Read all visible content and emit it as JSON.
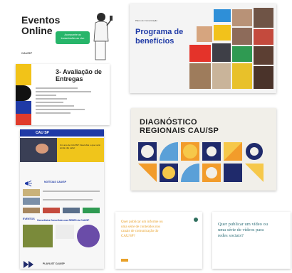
{
  "cards": {
    "eventos": {
      "title_line1": "Eventos",
      "title_line2": "Online",
      "bubble_text": "Acompanhe as transmissões ao vivo",
      "logo_text": "CAU/SP",
      "colors": {
        "bubble": "#27b56a",
        "title": "#222222"
      }
    },
    "programa": {
      "kicker": "Plano de Comunicação",
      "title_line1": "Programa de",
      "title_line2": "benefícios",
      "colors": {
        "title": "#1f3aa6",
        "bg": "#f4f4f4"
      }
    },
    "avaliacao": {
      "title_line1": "3- Avaliação de",
      "title_line2": "Entregas",
      "colors": {
        "blue": "#1f3aa6",
        "yellow": "#f2c318",
        "red": "#e03b2b",
        "black": "#111111"
      }
    },
    "diagnostico": {
      "title_line1": "DIAGNÓSTICO",
      "title_line2": "REGIONAIS CAU/SP",
      "colors": {
        "bg": "#f1efe9",
        "navy": "#1f2a6b",
        "orange": "#f29c2b",
        "yellow": "#f6c84a",
        "blue": "#5aa0d8"
      }
    },
    "newsletter": {
      "header_logo": "CAU SP",
      "headline": "Um ano de CAU/SP: Descubra o que você ainda não sabe!",
      "section_noticias": "NOTÍCIAS CAU/SP",
      "section_eventos": "EVENTOS",
      "section_conselheiros": "Conselheira Conselheira nas REDES do CAU/SP",
      "playlist_label": "PLAYLIST CAU/SP"
    },
    "quer_orange": {
      "text": "Quer publicar um informe ou uma série de conteúdos nos canais de comunicação do CAU/SP?",
      "colors": {
        "text": "#e8a12a",
        "dot": "#2f6f5e"
      }
    },
    "quer_teal": {
      "text": "Quer publicar um vídeo ou uma série de vídeos para redes sociais?",
      "colors": {
        "text": "#2e6f78"
      }
    }
  }
}
